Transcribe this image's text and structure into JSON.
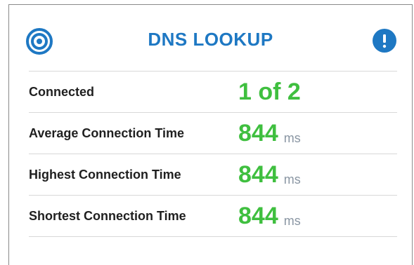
{
  "widget": {
    "title": "DNS LOOKUP",
    "left_icon": "target-icon",
    "right_icon": "info-alert-icon",
    "accent_color": "#1e78c3",
    "value_color": "#3fbf3f"
  },
  "metrics": [
    {
      "label": "Connected",
      "value": "1 of 2",
      "unit": ""
    },
    {
      "label": "Average Connection Time",
      "value": "844",
      "unit": "ms"
    },
    {
      "label": "Highest Connection Time",
      "value": "844",
      "unit": "ms"
    },
    {
      "label": "Shortest Connection Time",
      "value": "844",
      "unit": "ms"
    }
  ]
}
